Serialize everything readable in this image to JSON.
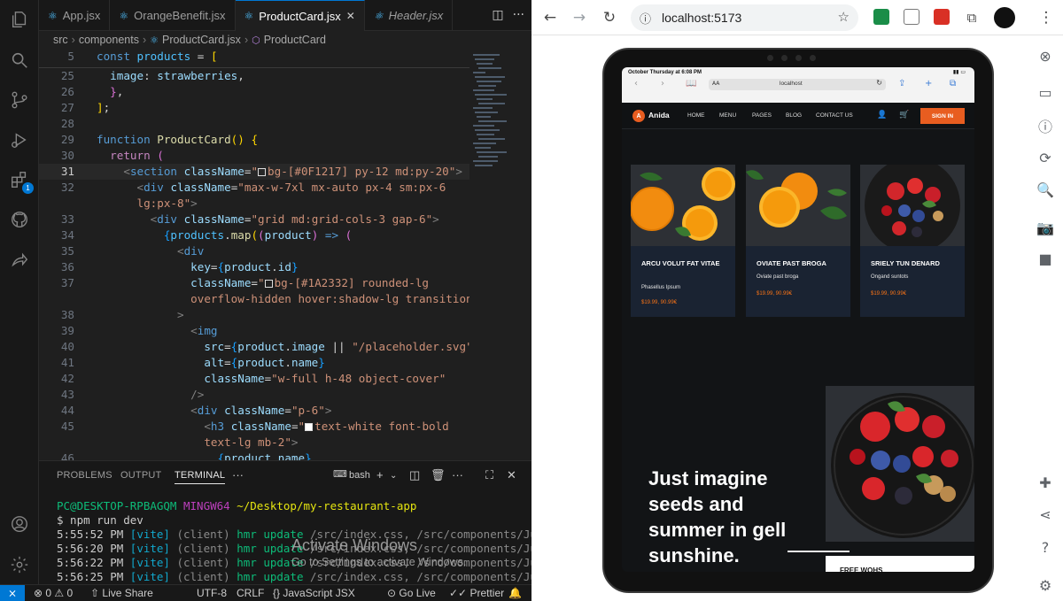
{
  "vscode": {
    "tabs": [
      {
        "label": "App.jsx",
        "active": false
      },
      {
        "label": "OrangeBenefit.jsx",
        "active": false
      },
      {
        "label": "ProductCard.jsx",
        "active": true
      },
      {
        "label": "Header.jsx",
        "active": false
      }
    ],
    "breadcrumb": {
      "folder1": "src",
      "folder2": "components",
      "file": "ProductCard.jsx",
      "symbol": "ProductCard"
    },
    "code_lines": [
      {
        "num": "5",
        "html": "<span class=\"kw\">const</span> <span class=\"cs\">products</span> = <span class=\"br1\">[</span>"
      },
      {
        "num": "25",
        "html": "  <span class=\"vr\">image</span>: <span class=\"vr\">strawberries</span>,"
      },
      {
        "num": "26",
        "html": "  <span class=\"br2\">}</span>,"
      },
      {
        "num": "27",
        "html": "<span class=\"br1\">]</span>;"
      },
      {
        "num": "28",
        "html": ""
      },
      {
        "num": "29",
        "html": "<span class=\"kw\">function</span> <span class=\"fn\">ProductCard</span><span class=\"br1\">()</span> <span class=\"br1\">{</span>"
      },
      {
        "num": "30",
        "html": "  <span class=\"kp\">return</span> <span class=\"br2\">(</span>"
      },
      {
        "num": "31",
        "html": "    <span class=\"pn\">&lt;</span><span class=\"tg\">section</span> <span class=\"at\">className</span>=<span class=\"st\">\"<span class=\"sq\"></span>bg-[#0F1217] py-12 md:py-20\"</span><span class=\"pn\">&gt;</span>"
      },
      {
        "num": "32",
        "html": "      <span class=\"pn\">&lt;</span><span class=\"tg\">div</span> <span class=\"at\">className</span>=<span class=\"st\">\"max-w-7xl mx-auto px-4 sm:px-6</span>"
      },
      {
        "num": "",
        "html": "      <span class=\"st\">lg:px-8\"</span><span class=\"pn\">&gt;</span>"
      },
      {
        "num": "33",
        "html": "        <span class=\"pn\">&lt;</span><span class=\"tg\">div</span> <span class=\"at\">className</span>=<span class=\"st\">\"grid md:grid-cols-3 gap-6\"</span><span class=\"pn\">&gt;</span>"
      },
      {
        "num": "34",
        "html": "          <span class=\"br3\">{</span><span class=\"cs\">products</span>.<span class=\"fn\">map</span><span class=\"br1\">(</span><span class=\"br2\">(</span><span class=\"vr\">product</span><span class=\"br2\">)</span> <span class=\"kw\">=&gt;</span> <span class=\"br2\">(</span>"
      },
      {
        "num": "35",
        "html": "            <span class=\"pn\">&lt;</span><span class=\"tg\">div</span>"
      },
      {
        "num": "36",
        "html": "              <span class=\"at\">key</span>=<span class=\"br3\">{</span><span class=\"vr\">product</span>.<span class=\"vr\">id</span><span class=\"br3\">}</span>"
      },
      {
        "num": "37",
        "html": "              <span class=\"at\">className</span>=<span class=\"st\">\"<span class=\"sq\"></span>bg-[#1A2332] rounded-lg</span>"
      },
      {
        "num": "",
        "html": "              <span class=\"st\">overflow-hidden hover:shadow-lg transition\"</span>"
      },
      {
        "num": "38",
        "html": "            <span class=\"pn\">&gt;</span>"
      },
      {
        "num": "39",
        "html": "              <span class=\"pn\">&lt;</span><span class=\"tg\">img</span>"
      },
      {
        "num": "40",
        "html": "                <span class=\"at\">src</span>=<span class=\"br3\">{</span><span class=\"vr\">product</span>.<span class=\"vr\">image</span> || <span class=\"st\">\"/placeholder.svg\"</span><span class=\"br3\">}</span>"
      },
      {
        "num": "41",
        "html": "                <span class=\"at\">alt</span>=<span class=\"br3\">{</span><span class=\"vr\">product</span>.<span class=\"vr\">name</span><span class=\"br3\">}</span>"
      },
      {
        "num": "42",
        "html": "                <span class=\"at\">className</span>=<span class=\"st\">\"w-full h-48 object-cover\"</span>"
      },
      {
        "num": "43",
        "html": "              <span class=\"pn\">/&gt;</span>"
      },
      {
        "num": "44",
        "html": "              <span class=\"pn\">&lt;</span><span class=\"tg\">div</span> <span class=\"at\">className</span>=<span class=\"st\">\"p-6\"</span><span class=\"pn\">&gt;</span>"
      },
      {
        "num": "45",
        "html": "                <span class=\"pn\">&lt;</span><span class=\"tg\">h3</span> <span class=\"at\">className</span>=<span class=\"st\">\"<span class=\"sq white\"></span>text-white font-bold</span>"
      },
      {
        "num": "",
        "html": "                <span class=\"st\">text-lg mb-2\"</span><span class=\"pn\">&gt;</span>"
      },
      {
        "num": "46",
        "html": "                  <span class=\"br3\">{</span><span class=\"vr\">product</span>.<span class=\"vr\">name</span><span class=\"br3\">}</span>"
      }
    ],
    "panel": {
      "tabs": [
        "PROBLEMS",
        "OUTPUT",
        "TERMINAL"
      ],
      "active_tab": "TERMINAL",
      "shell": "bash",
      "prompt_user": "PC@DESKTOP-RPBAGQM",
      "prompt_env": "MINGW64",
      "prompt_path": "~/Desktop/my-restaurant-app",
      "command": "$ npm run dev",
      "log": [
        {
          "time": "5:55:52 PM",
          "tag": "[vite]",
          "text": " (client) hmr update /src/index.css, /src/components/Ju"
        },
        {
          "time": "5:56:20 PM",
          "tag": "[vite]",
          "text": " (client) hmr update /src/index.css, /src/components/Ju"
        },
        {
          "time": "5:56:22 PM",
          "tag": "[vite]",
          "text": " (client) hmr update /src/index.css, /src/components/Ju"
        },
        {
          "time": "5:56:25 PM",
          "tag": "[vite]",
          "text": " (client) hmr update /src/index.css, /src/components/Ju"
        }
      ]
    },
    "statusbar": {
      "errors": "0",
      "warnings": "0",
      "live_share": "Live Share",
      "encoding": "UTF-8",
      "eol": "CRLF",
      "language": "JavaScript JSX",
      "go_live": "Go Live",
      "prettier": "Prettier",
      "accent": "#0078d4"
    }
  },
  "chrome": {
    "url": "localhost:5173",
    "site": {
      "status_time": "October Thursday at 6:08 PM",
      "safari_url": "localhost",
      "safari_aa": "AA",
      "brand_initial": "A",
      "brand": "Anida",
      "nav": [
        "HOME",
        "MENU",
        "PAGES",
        "BLOG",
        "CONTACT US"
      ],
      "signin": "SIGN IN",
      "accent": "#e85d20",
      "cards": [
        {
          "title": "ARCU VOLUT FAT VITAE",
          "subtitle": "Phasellus Ipsum",
          "price": "$19.99, 90.99€"
        },
        {
          "title": "OVIATE PAST BROGA",
          "subtitle": "Oviate past broga",
          "price": "$19.99, 90.99€"
        },
        {
          "title": "SRIELY TUN DENARD",
          "subtitle": "Ongand suntots",
          "price": "$19.99, 90.99€"
        }
      ],
      "hero_text": "Just imagine seeds and summer in gell sunshine.",
      "hero_button": "FREE WOHS"
    }
  },
  "watermark": {
    "line1": "Activate Windows",
    "line2": "Go to Settings to activate Windows."
  }
}
